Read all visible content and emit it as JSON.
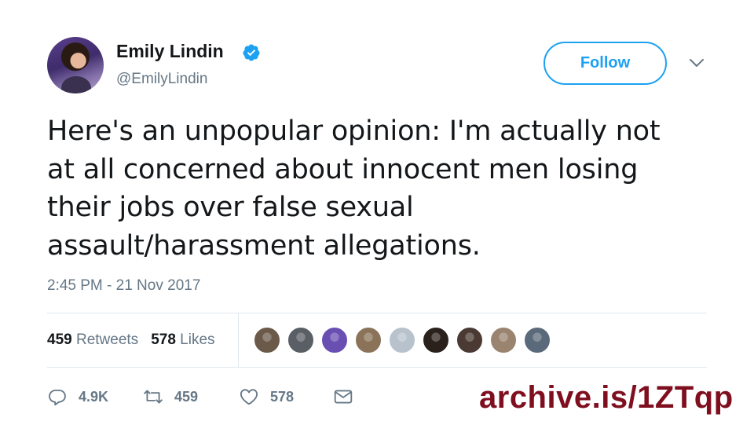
{
  "author": {
    "name": "Emily Lindin",
    "handle": "@EmilyLindin",
    "verified": true
  },
  "header": {
    "follow_label": "Follow",
    "menu_icon": "chevron-down-icon"
  },
  "tweet": {
    "lines": [
      "Here's an unpopular opinion: I'm actually not",
      "at all concerned about innocent men losing",
      "their jobs over false sexual",
      "assault/harassment allegations."
    ],
    "timestamp": "2:45 PM - 21 Nov 2017"
  },
  "stats": {
    "retweets_count": "459",
    "retweets_label": "Retweets",
    "likes_count": "578",
    "likes_label": "Likes",
    "liker_colors": [
      "#6b5a4a",
      "#5a5f66",
      "#6a4fb3",
      "#8a7358",
      "#b8c2cc",
      "#2b211c",
      "#4a3a33",
      "#9a8470",
      "#5b6a7a"
    ]
  },
  "actions": {
    "reply_count": "4.9K",
    "retweet_count": "459",
    "like_count": "578"
  },
  "colors": {
    "accent": "#1da1f2",
    "muted": "#657786",
    "watermark": "#7f0f1f"
  },
  "watermark": "archive.is/1ZTqp"
}
